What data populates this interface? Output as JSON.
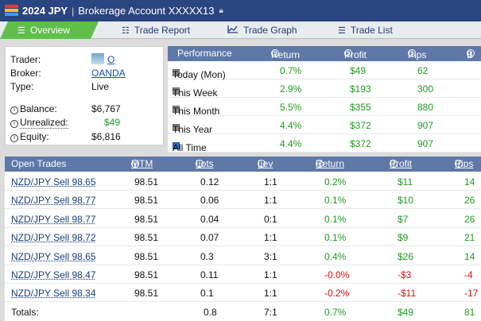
{
  "colors": {
    "topbar": "#2a4580",
    "active_tab": "#5fbf4a",
    "table_header": "#5e78a8",
    "positive": "#229922",
    "negative": "#dd1111",
    "link": "#1a4fa0"
  },
  "header": {
    "title": "2024 JPY",
    "separator": "|",
    "account": "Brokerage Account XXXXX13",
    "lock_icon": "lock-icon"
  },
  "tabs": [
    {
      "label": "Overview",
      "icon": "list-icon"
    },
    {
      "label": "Trade Report",
      "icon": "report-icon"
    },
    {
      "label": "Trade Graph",
      "icon": "graph-icon"
    },
    {
      "label": "Trade List",
      "icon": "list-lines-icon"
    }
  ],
  "account": {
    "trader_label": "Trader:",
    "trader_value": "O",
    "broker_label": "Broker:",
    "broker_value": "OANDA",
    "type_label": "Type:",
    "type_value": "Live",
    "balance_label": "Balance:",
    "balance_value": "$6,767",
    "unrealized_label": "Unrealized:",
    "unrealized_value": "$49",
    "equity_label": "Equity:",
    "equity_value": "$6,816"
  },
  "performance": {
    "headers": [
      "Performance",
      "Return",
      "Profit",
      "Pips",
      "B"
    ],
    "rows": [
      {
        "period": "Today (Mon)",
        "return": "0.7%",
        "profit": "$49",
        "pips": "62",
        "checked": false
      },
      {
        "period": "This Week",
        "return": "2.9%",
        "profit": "$193",
        "pips": "300",
        "checked": false
      },
      {
        "period": "This Month",
        "return": "5.5%",
        "profit": "$355",
        "pips": "880",
        "checked": false
      },
      {
        "period": "This Year",
        "return": "4.4%",
        "profit": "$372",
        "pips": "907",
        "checked": false
      },
      {
        "period": "All Time",
        "return": "4.4%",
        "profit": "$372",
        "pips": "907",
        "checked": true
      }
    ]
  },
  "open_trades": {
    "headers": [
      "Open Trades",
      "MTM",
      "Lots",
      "Lev",
      "Return",
      "Profit",
      "Pips"
    ],
    "rows": [
      {
        "pair": "NZD/JPY Sell 98.65",
        "mtm": "98.51",
        "lots": "0.12",
        "lev": "1:1",
        "return": "0.2%",
        "profit": "$11",
        "pips": "14",
        "neg": false
      },
      {
        "pair": "NZD/JPY Sell 98.77",
        "mtm": "98.51",
        "lots": "0.06",
        "lev": "1:1",
        "return": "0.1%",
        "profit": "$10",
        "pips": "26",
        "neg": false
      },
      {
        "pair": "NZD/JPY Sell 98.77",
        "mtm": "98.51",
        "lots": "0.04",
        "lev": "0:1",
        "return": "0.1%",
        "profit": "$7",
        "pips": "26",
        "neg": false
      },
      {
        "pair": "NZD/JPY Sell 98.72",
        "mtm": "98.51",
        "lots": "0.07",
        "lev": "1:1",
        "return": "0.1%",
        "profit": "$9",
        "pips": "21",
        "neg": false
      },
      {
        "pair": "NZD/JPY Sell 98.65",
        "mtm": "98.51",
        "lots": "0.3",
        "lev": "3:1",
        "return": "0.4%",
        "profit": "$26",
        "pips": "14",
        "neg": false
      },
      {
        "pair": "NZD/JPY Sell 98.47",
        "mtm": "98.51",
        "lots": "0.11",
        "lev": "1:1",
        "return": "-0.0%",
        "profit": "-$3",
        "pips": "-4",
        "neg": true
      },
      {
        "pair": "NZD/JPY Sell 98.34",
        "mtm": "98.51",
        "lots": "0.1",
        "lev": "1:1",
        "return": "-0.2%",
        "profit": "-$11",
        "pips": "-17",
        "neg": true
      }
    ],
    "totals": {
      "label": "Totals:",
      "lots": "0.8",
      "lev": "7:1",
      "return": "0.7%",
      "profit": "$49",
      "pips": "81"
    }
  }
}
